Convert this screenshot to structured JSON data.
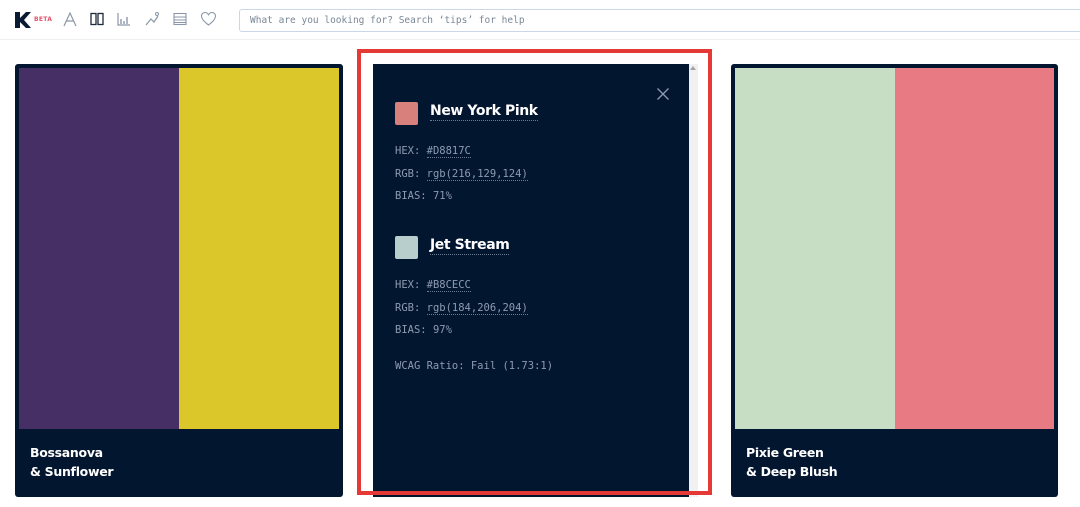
{
  "header": {
    "beta_label": "BETA",
    "nav_icons": [
      "type-icon",
      "compare-icon",
      "chart-icon",
      "trend-icon",
      "list-icon",
      "heart-icon"
    ],
    "search_placeholder": "What are you looking for? Search ‘tips’ for help"
  },
  "cards": [
    {
      "title_line1": "Bossanova",
      "title_line2": "& Sunflower",
      "colors": [
        "#452f64",
        "#dbc729"
      ]
    },
    {
      "title_line1": "Pixie Green",
      "title_line2": "& Deep Blush",
      "colors": [
        "#c7dec5",
        "#e87a83"
      ]
    }
  ],
  "detail": {
    "colors": [
      {
        "name": "New York Pink",
        "chip": "#D8817C",
        "hex_label": "HEX:",
        "hex": "#D8817C",
        "rgb_label": "RGB:",
        "rgb": "rgb(216,129,124)",
        "bias_label": "BIAS:",
        "bias": "71%"
      },
      {
        "name": "Jet Stream",
        "chip": "#B8CECC",
        "hex_label": "HEX:",
        "hex": "#B8CECC",
        "rgb_label": "RGB:",
        "rgb": "rgb(184,206,204)",
        "bias_label": "BIAS:",
        "bias": "97%"
      }
    ],
    "wcag": "WCAG Ratio: Fail (1.73:1)"
  },
  "theme": {
    "panel_bg": "#031630",
    "highlight": "#e53935"
  }
}
